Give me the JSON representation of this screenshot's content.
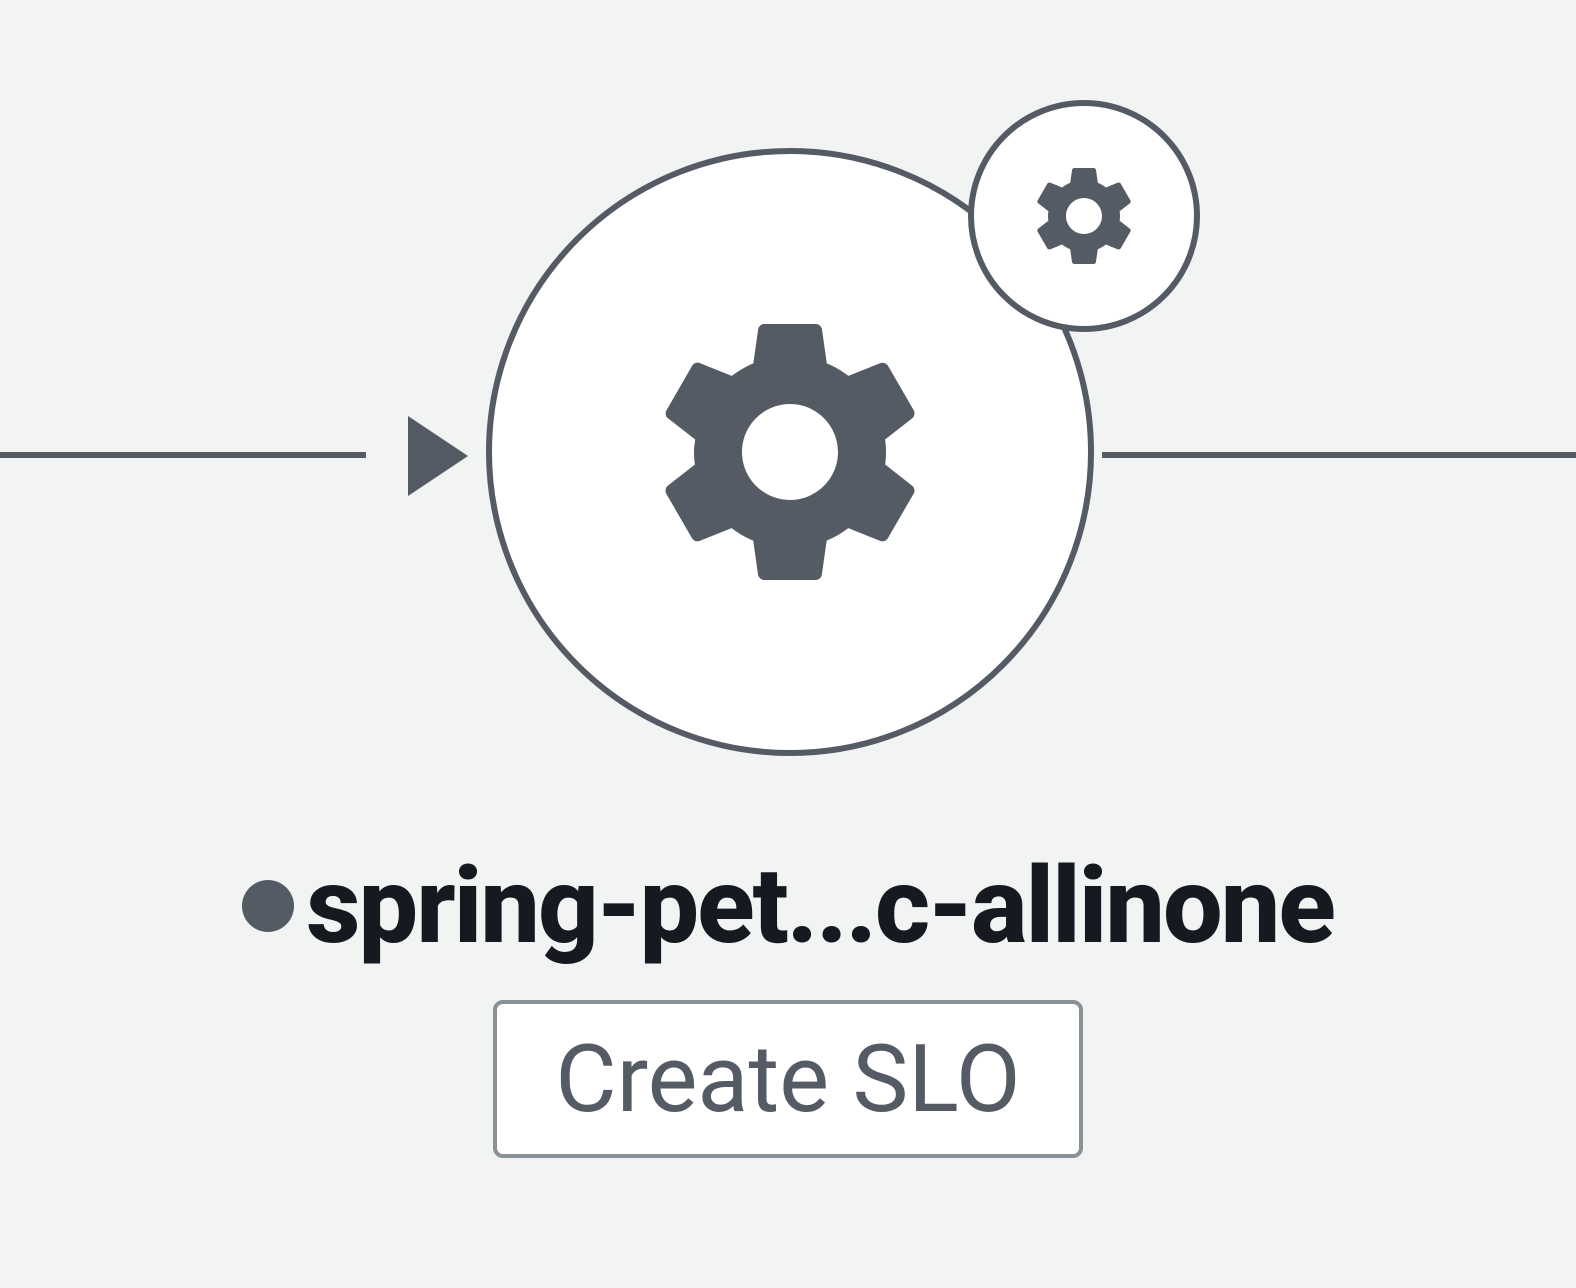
{
  "node": {
    "label": "spring-pet...c-allinone",
    "icon": "gear-icon",
    "badge_icon": "gear-icon",
    "status_color": "#545b64"
  },
  "actions": {
    "create_slo_label": "Create SLO"
  },
  "colors": {
    "stroke": "#545b64",
    "background": "#f2f3f3",
    "node_fill": "#ffffff",
    "text": "#16191f",
    "button_border": "#879196"
  }
}
